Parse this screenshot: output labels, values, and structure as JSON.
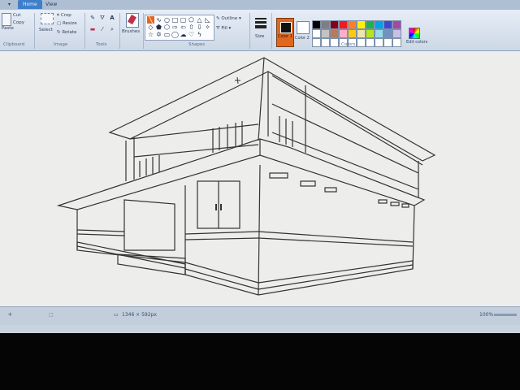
{
  "ribbon": {
    "tabs": [
      "Home",
      "View"
    ],
    "clipboard": {
      "paste": "Paste",
      "cut": "Cut",
      "copy": "Copy",
      "label": "Clipboard"
    },
    "image": {
      "select": "Select",
      "crop": "Crop",
      "resize": "Resize",
      "rotate": "Rotate",
      "label": "Image"
    },
    "tools": {
      "label": "Tools"
    },
    "brushes": "Brushes",
    "shapes": {
      "label": "Shapes",
      "outline": "Outline",
      "fill": "Fill"
    },
    "size": "Size",
    "color1": "Color 1",
    "color2": "Color 2",
    "colors_label": "Colors",
    "edit_colors": "Edit colors"
  },
  "palette": [
    "#000000",
    "#7f7f7f",
    "#880015",
    "#ed1c24",
    "#ff7f27",
    "#fff200",
    "#22b14c",
    "#00a2e8",
    "#3f48cc",
    "#a349a4",
    "#ffffff",
    "#c3c3c3",
    "#b97a57",
    "#ffaec9",
    "#ffc90e",
    "#efe4b0",
    "#b5e61d",
    "#99d9ea",
    "#7092be",
    "#c8bfe7",
    "#ffffff",
    "#ffffff",
    "#ffffff",
    "#ffffff",
    "#ffffff",
    "#ffffff",
    "#ffffff",
    "#ffffff",
    "#ffffff",
    "#ffffff"
  ],
  "status": {
    "dimensions": "1346 × 592px",
    "zoom": "100%"
  },
  "colors": {
    "accent": "#3f7fc9",
    "color1": "#e2671e"
  }
}
